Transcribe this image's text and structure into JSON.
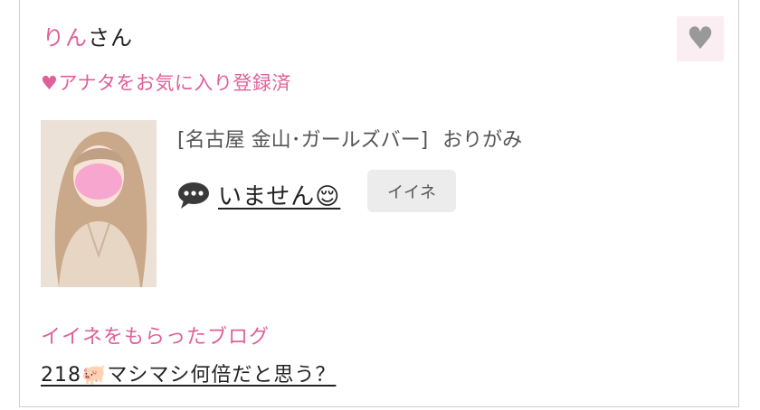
{
  "user": {
    "name": "りん",
    "suffix": "さん"
  },
  "favorite": {
    "icon": "heart-icon",
    "status_text": "♥アナタをお気に入り登録済"
  },
  "profile": {
    "avatar": "girl-photo-avatar",
    "shop": "[名古屋 金山･ガールズバー]",
    "name": "おりがみ",
    "status_icon": "chat-bubble-icon",
    "status": "いません😌"
  },
  "iine_button": {
    "label": "イイネ"
  },
  "blog": {
    "heading": "イイネをもらったブログ",
    "link_text": "218🐖マシマシ何倍だと思う？"
  },
  "colors": {
    "accent": "#e0609a",
    "fav_bg": "#fbeef2",
    "button_bg": "#ececec"
  }
}
